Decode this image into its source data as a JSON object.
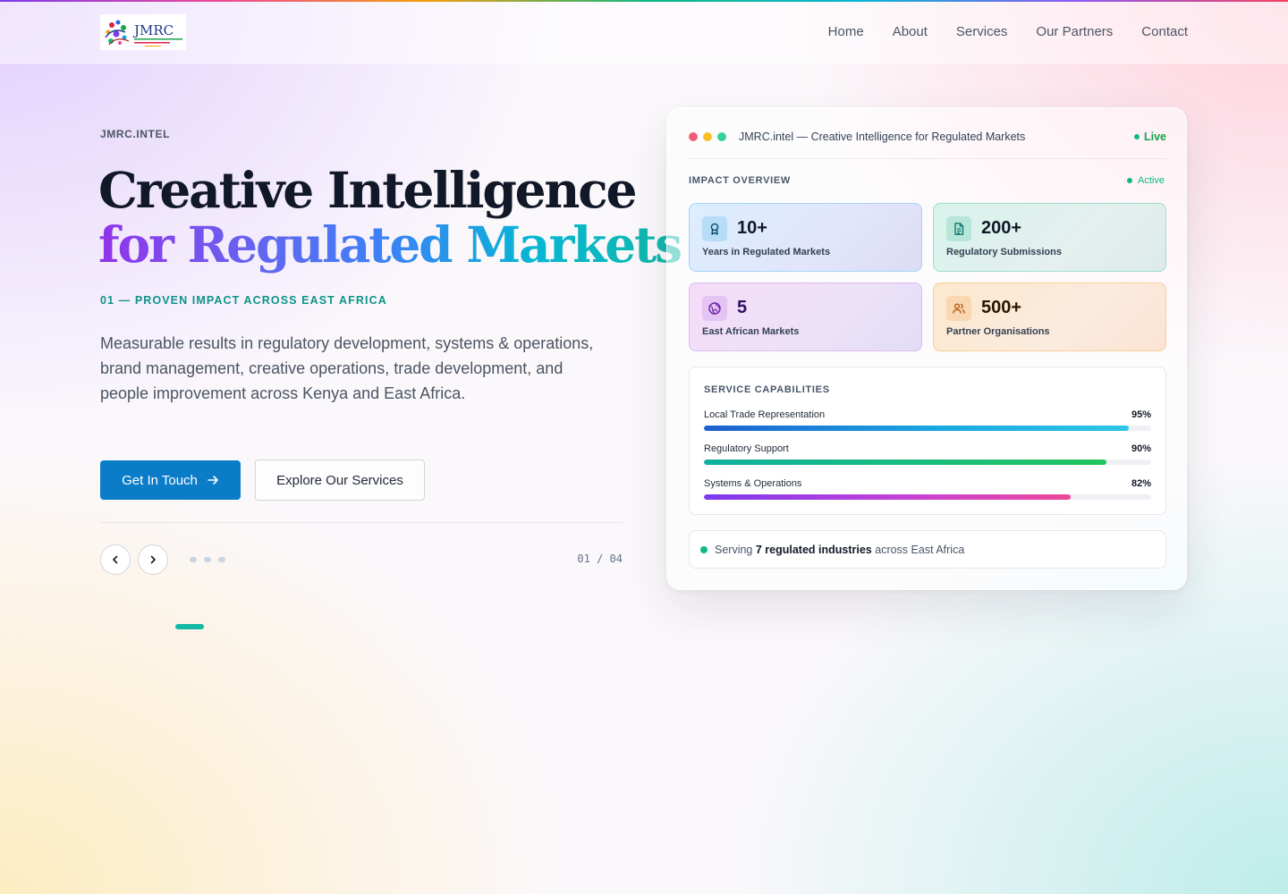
{
  "nav": {
    "logo_text": "JMRC",
    "links": [
      "Home",
      "About",
      "Services",
      "Our Partners",
      "Contact"
    ]
  },
  "hero": {
    "eyebrow": "JMRC.INTEL",
    "headline_line1": "Creative Intelligence",
    "headline_line2": "for Regulated Markets",
    "kicker": "01 — PROVEN IMPACT ACROSS EAST AFRICA",
    "lead": "Measurable results in regulatory development, systems & operations, brand management, creative operations, trade development, and people improvement across Kenya and East Africa.",
    "cta_primary": "Get In Touch",
    "cta_secondary": "Explore Our Services",
    "slide_counter": "01 / 04",
    "slides_total": 4,
    "slide_active": 1
  },
  "dashboard": {
    "window_title": "JMRC.intel — Creative Intelligence for Regulated Markets",
    "live_label": "Live",
    "impact_label": "IMPACT OVERVIEW",
    "active_label": "Active",
    "stats": [
      {
        "value": "10+",
        "label": "Years in Regulated Markets",
        "icon": "award-icon"
      },
      {
        "value": "200+",
        "label": "Regulatory Submissions",
        "icon": "document-icon"
      },
      {
        "value": "5",
        "label": "East African Markets",
        "icon": "globe-icon"
      },
      {
        "value": "500+",
        "label": "Partner Organisations",
        "icon": "users-icon"
      }
    ],
    "capabilities_label": "SERVICE CAPABILITIES",
    "capabilities": [
      {
        "name": "Local Trade Representation",
        "percent": "95%",
        "value": 95
      },
      {
        "name": "Regulatory Support",
        "percent": "90%",
        "value": 90
      },
      {
        "name": "Systems & Operations",
        "percent": "82%",
        "value": 82
      }
    ],
    "serving": {
      "prefix": "Serving ",
      "highlight": "7 regulated industries",
      "suffix": " across East Africa"
    }
  },
  "colors": {
    "primary_button": "#0b7cc7",
    "accent_teal": "#14b8a6",
    "live_green": "#16a34a"
  }
}
